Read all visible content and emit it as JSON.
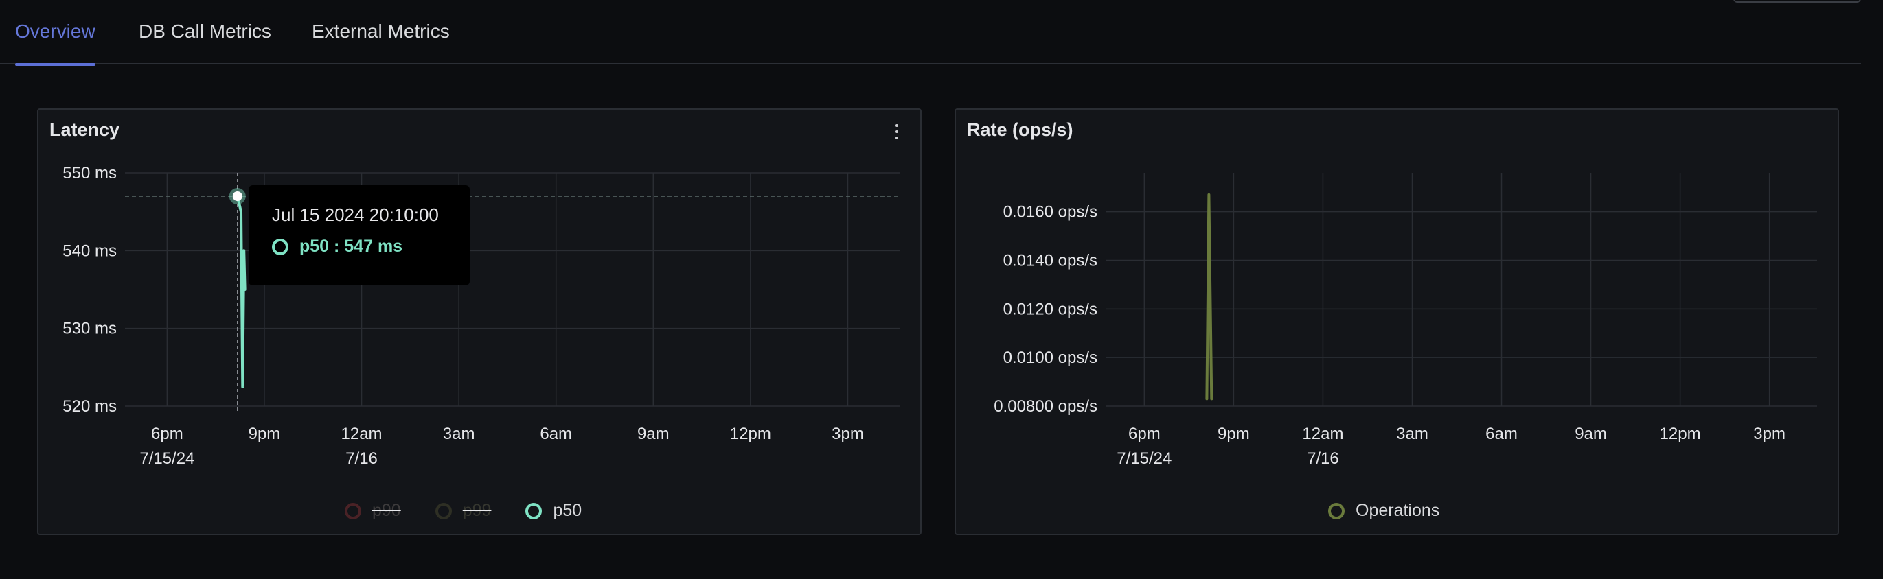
{
  "tabs": [
    {
      "label": "Overview",
      "active": true
    },
    {
      "label": "DB Call Metrics",
      "active": false
    },
    {
      "label": "External Metrics",
      "active": false
    }
  ],
  "latency_panel": {
    "title": "Latency",
    "menu_icon": "vertical-ellipsis-icon",
    "tooltip": {
      "date": "Jul 15 2024 20:10:00",
      "series": "p50",
      "value": "547 ms",
      "text": "p50 : 547 ms"
    },
    "legend": [
      {
        "label": "p90",
        "color": "#4a2226",
        "hidden": true
      },
      {
        "label": "p99",
        "color": "#2e2f24",
        "hidden": true
      },
      {
        "label": "p50",
        "color": "#7fe2c4",
        "hidden": false
      }
    ]
  },
  "rate_panel": {
    "title": "Rate (ops/s)",
    "legend": [
      {
        "label": "Operations",
        "color": "#6a7b3c",
        "hidden": false
      }
    ]
  },
  "chart_data": [
    {
      "type": "line",
      "title": "Latency",
      "xlabel": "",
      "ylabel": "",
      "x_ticks": [
        {
          "line1": "6pm",
          "line2": "7/15/24",
          "hour": 18
        },
        {
          "line1": "9pm",
          "line2": "",
          "hour": 21
        },
        {
          "line1": "12am",
          "line2": "7/16",
          "hour": 24
        },
        {
          "line1": "3am",
          "line2": "",
          "hour": 27
        },
        {
          "line1": "6am",
          "line2": "",
          "hour": 30
        },
        {
          "line1": "9am",
          "line2": "",
          "hour": 33
        },
        {
          "line1": "12pm",
          "line2": "",
          "hour": 36
        },
        {
          "line1": "3pm",
          "line2": "",
          "hour": 39
        }
      ],
      "x_range_hours": [
        16.7,
        40.6
      ],
      "y_ticks": [
        {
          "label": "550 ms",
          "value": 550
        },
        {
          "label": "540 ms",
          "value": 540
        },
        {
          "label": "530 ms",
          "value": 530
        },
        {
          "label": "520 ms",
          "value": 520
        }
      ],
      "ylim": [
        520,
        550
      ],
      "grid": true,
      "legend_position": "bottom",
      "crosshair": {
        "hour": 20.17,
        "value": 547
      },
      "series": [
        {
          "name": "p50",
          "color": "#7fe2c4",
          "points": [
            {
              "hour": 20.17,
              "value": 547
            },
            {
              "hour": 20.28,
              "value": 545
            },
            {
              "hour": 20.33,
              "value": 522.5
            },
            {
              "hour": 20.37,
              "value": 540
            },
            {
              "hour": 20.4,
              "value": 535
            }
          ]
        }
      ]
    },
    {
      "type": "line",
      "title": "Rate (ops/s)",
      "xlabel": "",
      "ylabel": "",
      "x_ticks": [
        {
          "line1": "6pm",
          "line2": "7/15/24",
          "hour": 18
        },
        {
          "line1": "9pm",
          "line2": "",
          "hour": 21
        },
        {
          "line1": "12am",
          "line2": "7/16",
          "hour": 24
        },
        {
          "line1": "3am",
          "line2": "",
          "hour": 27
        },
        {
          "line1": "6am",
          "line2": "",
          "hour": 30
        },
        {
          "line1": "9am",
          "line2": "",
          "hour": 33
        },
        {
          "line1": "12pm",
          "line2": "",
          "hour": 36
        },
        {
          "line1": "3pm",
          "line2": "",
          "hour": 39
        }
      ],
      "x_range_hours": [
        16.7,
        40.6
      ],
      "y_ticks": [
        {
          "label": "0.0160 ops/s",
          "value": 0.016
        },
        {
          "label": "0.0140 ops/s",
          "value": 0.014
        },
        {
          "label": "0.0120 ops/s",
          "value": 0.012
        },
        {
          "label": "0.0100 ops/s",
          "value": 0.01
        },
        {
          "label": "0.00800 ops/s",
          "value": 0.008
        }
      ],
      "ylim": [
        0.008,
        0.0176
      ],
      "grid": true,
      "legend_position": "bottom",
      "series": [
        {
          "name": "Operations",
          "color": "#6a7b3c",
          "points": [
            {
              "hour": 20.1,
              "value": 0.0083
            },
            {
              "hour": 20.17,
              "value": 0.0167
            },
            {
              "hour": 20.26,
              "value": 0.0083
            }
          ]
        }
      ]
    }
  ]
}
